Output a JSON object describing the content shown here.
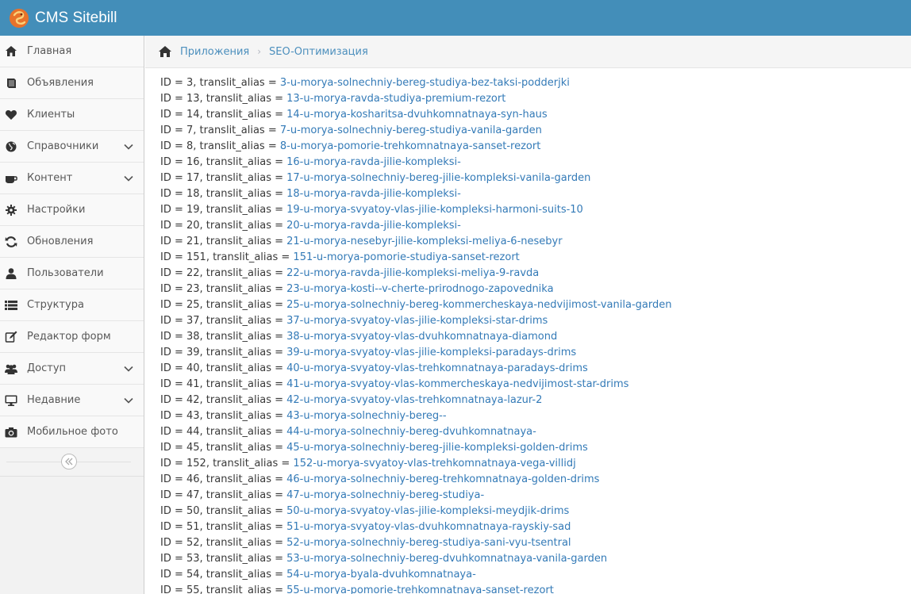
{
  "brand": {
    "title": "CMS Sitebill"
  },
  "sidebar": {
    "items": [
      {
        "label": "Главная",
        "icon": "home-icon",
        "has_caret": false
      },
      {
        "label": "Объявления",
        "icon": "book-icon",
        "has_caret": false
      },
      {
        "label": "Клиенты",
        "icon": "heart-icon",
        "has_caret": false
      },
      {
        "label": "Справочники",
        "icon": "globe-icon",
        "has_caret": true
      },
      {
        "label": "Контент",
        "icon": "coffee-icon",
        "has_caret": true
      },
      {
        "label": "Настройки",
        "icon": "gear-icon",
        "has_caret": false
      },
      {
        "label": "Обновления",
        "icon": "refresh-icon",
        "has_caret": false
      },
      {
        "label": "Пользователи",
        "icon": "user-icon",
        "has_caret": false
      },
      {
        "label": "Структура",
        "icon": "list-icon",
        "has_caret": false
      },
      {
        "label": "Редактор форм",
        "icon": "edit-icon",
        "has_caret": false
      },
      {
        "label": "Доступ",
        "icon": "users-icon",
        "has_caret": true
      },
      {
        "label": "Недавние",
        "icon": "desktop-icon",
        "has_caret": true
      },
      {
        "label": "Мобильное фото",
        "icon": "camera-icon",
        "has_caret": false
      }
    ]
  },
  "breadcrumbs": {
    "items": [
      "Приложения",
      "SEO-Оптимизация"
    ]
  },
  "rows": [
    {
      "prefix": "ID = 3, translit_alias = ",
      "alias": "3-u-morya-solnechniy-bereg-studiya-bez-taksi-podderjki"
    },
    {
      "prefix": "ID = 13, translit_alias = ",
      "alias": "13-u-morya-ravda-studiya-premium-rezort"
    },
    {
      "prefix": "ID = 14, translit_alias = ",
      "alias": "14-u-morya-kosharitsa-dvuhkomnatnaya-syn-haus"
    },
    {
      "prefix": "ID = 7, translit_alias = ",
      "alias": "7-u-morya-solnechniy-bereg-studiya-vanila-garden"
    },
    {
      "prefix": "ID = 8, translit_alias = ",
      "alias": "8-u-morya-pomorie-trehkomnatnaya-sanset-rezort"
    },
    {
      "prefix": "ID = 16, translit_alias = ",
      "alias": "16-u-morya-ravda-jilie-kompleksi-"
    },
    {
      "prefix": "ID = 17, translit_alias = ",
      "alias": "17-u-morya-solnechniy-bereg-jilie-kompleksi-vanila-garden"
    },
    {
      "prefix": "ID = 18, translit_alias = ",
      "alias": "18-u-morya-ravda-jilie-kompleksi-"
    },
    {
      "prefix": "ID = 19, translit_alias = ",
      "alias": "19-u-morya-svyatoy-vlas-jilie-kompleksi-harmoni-suits-10"
    },
    {
      "prefix": "ID = 20, translit_alias = ",
      "alias": "20-u-morya-ravda-jilie-kompleksi-"
    },
    {
      "prefix": "ID = 21, translit_alias = ",
      "alias": "21-u-morya-nesebyr-jilie-kompleksi-meliya-6-nesebyr"
    },
    {
      "prefix": "ID = 151, translit_alias = ",
      "alias": "151-u-morya-pomorie-studiya-sanset-rezort"
    },
    {
      "prefix": "ID = 22, translit_alias = ",
      "alias": "22-u-morya-ravda-jilie-kompleksi-meliya-9-ravda"
    },
    {
      "prefix": "ID = 23, translit_alias = ",
      "alias": "23-u-morya-kosti--v-cherte-prirodnogo-zapovednika"
    },
    {
      "prefix": "ID = 25, translit_alias = ",
      "alias": "25-u-morya-solnechniy-bereg-kommercheskaya-nedvijimost-vanila-garden"
    },
    {
      "prefix": "ID = 37, translit_alias = ",
      "alias": "37-u-morya-svyatoy-vlas-jilie-kompleksi-star-drims"
    },
    {
      "prefix": "ID = 38, translit_alias = ",
      "alias": "38-u-morya-svyatoy-vlas-dvuhkomnatnaya-diamond"
    },
    {
      "prefix": "ID = 39, translit_alias = ",
      "alias": "39-u-morya-svyatoy-vlas-jilie-kompleksi-paradays-drims"
    },
    {
      "prefix": "ID = 40, translit_alias = ",
      "alias": "40-u-morya-svyatoy-vlas-trehkomnatnaya-paradays-drims"
    },
    {
      "prefix": "ID = 41, translit_alias = ",
      "alias": "41-u-morya-svyatoy-vlas-kommercheskaya-nedvijimost-star-drims"
    },
    {
      "prefix": "ID = 42, translit_alias = ",
      "alias": "42-u-morya-svyatoy-vlas-trehkomnatnaya-lazur-2"
    },
    {
      "prefix": "ID = 43, translit_alias = ",
      "alias": "43-u-morya-solnechniy-bereg--"
    },
    {
      "prefix": "ID = 44, translit_alias = ",
      "alias": "44-u-morya-solnechniy-bereg-dvuhkomnatnaya-"
    },
    {
      "prefix": "ID = 45, translit_alias = ",
      "alias": "45-u-morya-solnechniy-bereg-jilie-kompleksi-golden-drims"
    },
    {
      "prefix": "ID = 152, translit_alias = ",
      "alias": "152-u-morya-svyatoy-vlas-trehkomnatnaya-vega-villidj"
    },
    {
      "prefix": "ID = 46, translit_alias = ",
      "alias": "46-u-morya-solnechniy-bereg-trehkomnatnaya-golden-drims"
    },
    {
      "prefix": "ID = 47, translit_alias = ",
      "alias": "47-u-morya-solnechniy-bereg-studiya-"
    },
    {
      "prefix": "ID = 50, translit_alias = ",
      "alias": "50-u-morya-svyatoy-vlas-jilie-kompleksi-meydjik-drims"
    },
    {
      "prefix": "ID = 51, translit_alias = ",
      "alias": "51-u-morya-svyatoy-vlas-dvuhkomnatnaya-rayskiy-sad"
    },
    {
      "prefix": "ID = 52, translit_alias = ",
      "alias": "52-u-morya-solnechniy-bereg-studiya-sani-vyu-tsentral"
    },
    {
      "prefix": "ID = 53, translit_alias = ",
      "alias": "53-u-morya-solnechniy-bereg-dvuhkomnatnaya-vanila-garden"
    },
    {
      "prefix": "ID = 54, translit_alias = ",
      "alias": "54-u-morya-byala-dvuhkomnatnaya-"
    },
    {
      "prefix": "ID = 55, translit_alias = ",
      "alias": "55-u-morya-pomorie-trehkomnatnaya-sanset-rezort"
    }
  ]
}
